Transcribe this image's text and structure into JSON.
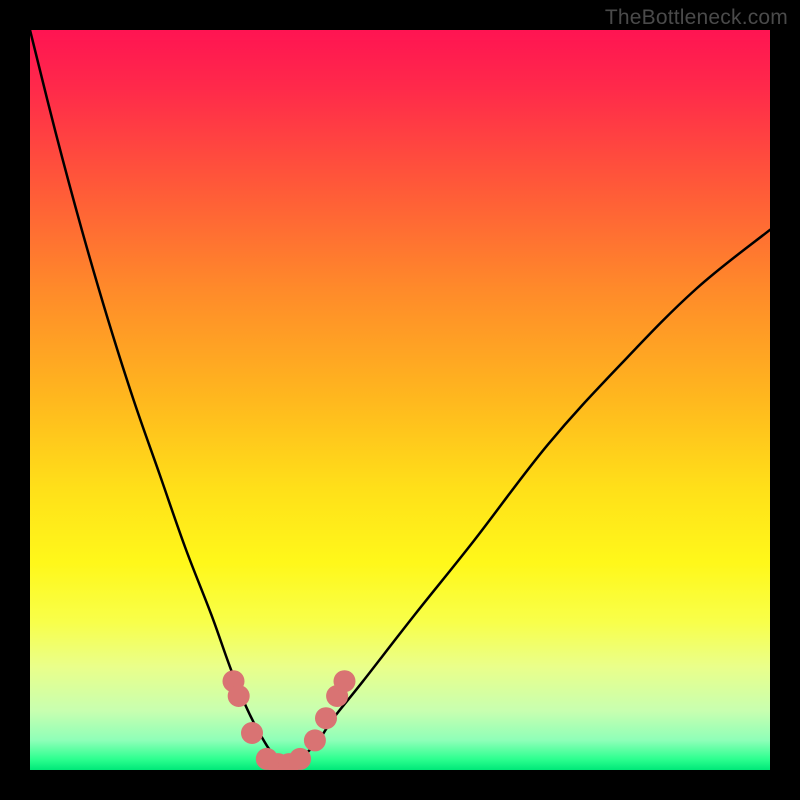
{
  "watermark": "TheBottleneck.com",
  "chart_data": {
    "type": "line",
    "title": "",
    "xlabel": "",
    "ylabel": "",
    "xlim": [
      0,
      100
    ],
    "ylim": [
      0,
      100
    ],
    "curve": {
      "name": "bottleneck-curve",
      "description": "V-shaped bottleneck curve: steep descent from top-left, flat minimum near x≈34, rising gently to right edge",
      "x": [
        0,
        3.5,
        7,
        10.5,
        14,
        17.5,
        21,
        24.5,
        27,
        29,
        31,
        33,
        35,
        37,
        39,
        41,
        45,
        52,
        60,
        70,
        80,
        90,
        100
      ],
      "y": [
        100,
        86,
        73,
        61,
        50,
        40,
        30,
        21,
        14,
        9,
        5,
        2,
        1,
        2,
        4,
        7,
        12,
        21,
        31,
        44,
        55,
        65,
        73
      ]
    },
    "markers": {
      "name": "highlight-points",
      "color": "#d97373",
      "x": [
        27.5,
        28.2,
        30,
        32,
        33.5,
        35,
        36.5,
        38.5,
        40,
        41.5,
        42.5
      ],
      "y": [
        12,
        10,
        5,
        1.5,
        0.8,
        0.8,
        1.5,
        4,
        7,
        10,
        12
      ]
    },
    "gradient_stops": [
      {
        "offset": 0.0,
        "color": "#ff1452"
      },
      {
        "offset": 0.08,
        "color": "#ff2a4a"
      },
      {
        "offset": 0.2,
        "color": "#ff553a"
      },
      {
        "offset": 0.35,
        "color": "#ff8a2a"
      },
      {
        "offset": 0.5,
        "color": "#ffb81e"
      },
      {
        "offset": 0.62,
        "color": "#ffe019"
      },
      {
        "offset": 0.72,
        "color": "#fff81a"
      },
      {
        "offset": 0.8,
        "color": "#f8ff4a"
      },
      {
        "offset": 0.86,
        "color": "#eaff8a"
      },
      {
        "offset": 0.92,
        "color": "#c8ffb0"
      },
      {
        "offset": 0.96,
        "color": "#8effb8"
      },
      {
        "offset": 0.985,
        "color": "#2eff90"
      },
      {
        "offset": 1.0,
        "color": "#00e878"
      }
    ]
  }
}
